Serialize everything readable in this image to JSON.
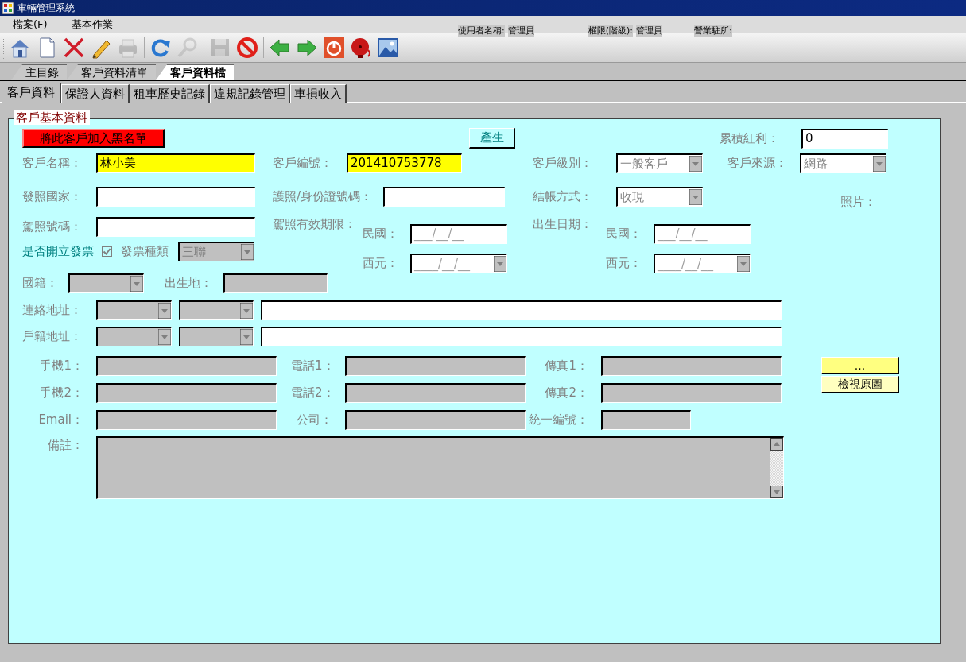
{
  "window": {
    "title": "車輛管理系統"
  },
  "menu": [
    "檔案(F)",
    "基本作業"
  ],
  "user_info": [
    {
      "label": "使用者名稱:",
      "value": "管理員"
    },
    {
      "label": "權限(階級):",
      "value": "管理員"
    },
    {
      "label": "營業駐所:"
    }
  ],
  "toolbar": [
    {
      "kind": "home",
      "disabled": false
    },
    {
      "kind": "new",
      "disabled": false
    },
    {
      "kind": "delete",
      "disabled": false
    },
    {
      "kind": "edit",
      "disabled": false
    },
    {
      "kind": "print",
      "disabled": true
    },
    {
      "kind": "refresh",
      "disabled": false
    },
    {
      "kind": "search",
      "disabled": true
    },
    {
      "kind": "save",
      "disabled": true
    },
    {
      "kind": "cancel",
      "disabled": false
    },
    {
      "kind": "back",
      "disabled": false
    },
    {
      "kind": "forward",
      "disabled": false
    },
    {
      "kind": "power",
      "disabled": false
    },
    {
      "kind": "alarm",
      "disabled": false
    },
    {
      "kind": "image",
      "disabled": false
    }
  ],
  "main_tabs": [
    {
      "label": "主目錄",
      "selected": false
    },
    {
      "label": "客戶資料清單",
      "selected": false
    },
    {
      "label": "客戶資料檔",
      "selected": true
    }
  ],
  "sub_tabs": [
    {
      "label": "客戶資料",
      "selected": true
    },
    {
      "label": "保證人資料",
      "selected": false
    },
    {
      "label": "租車歷史記錄",
      "selected": false
    },
    {
      "label": "違規記錄管理",
      "selected": false
    },
    {
      "label": "車損收入",
      "selected": false
    }
  ],
  "group_title": "客戶基本資料",
  "blacklist_button": "將此客戶加入黑名單",
  "generate_button": "產生",
  "bonus": {
    "label": "累積紅利：",
    "value": "0",
    "disabled": false
  },
  "customer_name": {
    "label": "客戶名稱：",
    "value": "林小美",
    "disabled": false,
    "highlighted": true
  },
  "customer_id": {
    "label": "客戶編號：",
    "value": "201410753778",
    "disabled": false,
    "highlighted": true
  },
  "customer_level": {
    "label": "客戶級別：",
    "value": "一般客戶",
    "disabled": false
  },
  "customer_source": {
    "label": "客戶來源：",
    "value": "網路",
    "disabled": false
  },
  "issuing_country": {
    "label": "發照國家：",
    "disabled": false
  },
  "passport_id": {
    "label": "護照/身份證號碼：",
    "disabled": false
  },
  "billing": {
    "label": "結帳方式：",
    "value": "收現",
    "disabled": false
  },
  "photo_label": "照片：",
  "license_no": {
    "label": "駕照號碼：",
    "disabled": false
  },
  "license_expiry": {
    "label": "駕照有效期限：",
    "roc": {
      "label": "民國：",
      "placeholder": "___/__/__",
      "disabled": false
    },
    "western": {
      "label": "西元：",
      "placeholder": "____/__/__",
      "disabled": false
    }
  },
  "birth_date": {
    "label": "出生日期：",
    "roc": {
      "label": "民國：",
      "placeholder": "___/__/__",
      "disabled": false
    },
    "western": {
      "label": "西元：",
      "placeholder": "____/__/__",
      "disabled": false
    }
  },
  "invoice": {
    "label": "是否開立發票",
    "checked": true,
    "disabled": true,
    "type_label": "發票種類",
    "type": {
      "value": "三聯",
      "disabled": true
    }
  },
  "nationality": {
    "label": "國籍：",
    "disabled": true
  },
  "birthplace": {
    "label": "出生地：",
    "disabled": true
  },
  "contact_address": {
    "label": "連絡地址：",
    "city": {
      "disabled": true
    },
    "district": {
      "disabled": true
    },
    "street": {
      "disabled": false
    }
  },
  "registered_address": {
    "label": "戶籍地址：",
    "city": {
      "disabled": true
    },
    "district": {
      "disabled": true
    },
    "street": {
      "disabled": false
    }
  },
  "mobile1": {
    "label": "手機1：",
    "disabled": true
  },
  "phone1": {
    "label": "電話1：",
    "disabled": true
  },
  "fax1": {
    "label": "傳真1：",
    "disabled": true
  },
  "mobile2": {
    "label": "手機2：",
    "disabled": true
  },
  "phone2": {
    "label": "電話2：",
    "disabled": true
  },
  "fax2": {
    "label": "傳真2：",
    "disabled": true
  },
  "email": {
    "label": "Email：",
    "disabled": true
  },
  "company": {
    "label": "公司：",
    "disabled": true
  },
  "tax_id": {
    "label": "統一編號：",
    "disabled": true
  },
  "remark": {
    "label": "備註：",
    "disabled": true
  },
  "browse_button": "...",
  "view_button": "檢視原圖"
}
